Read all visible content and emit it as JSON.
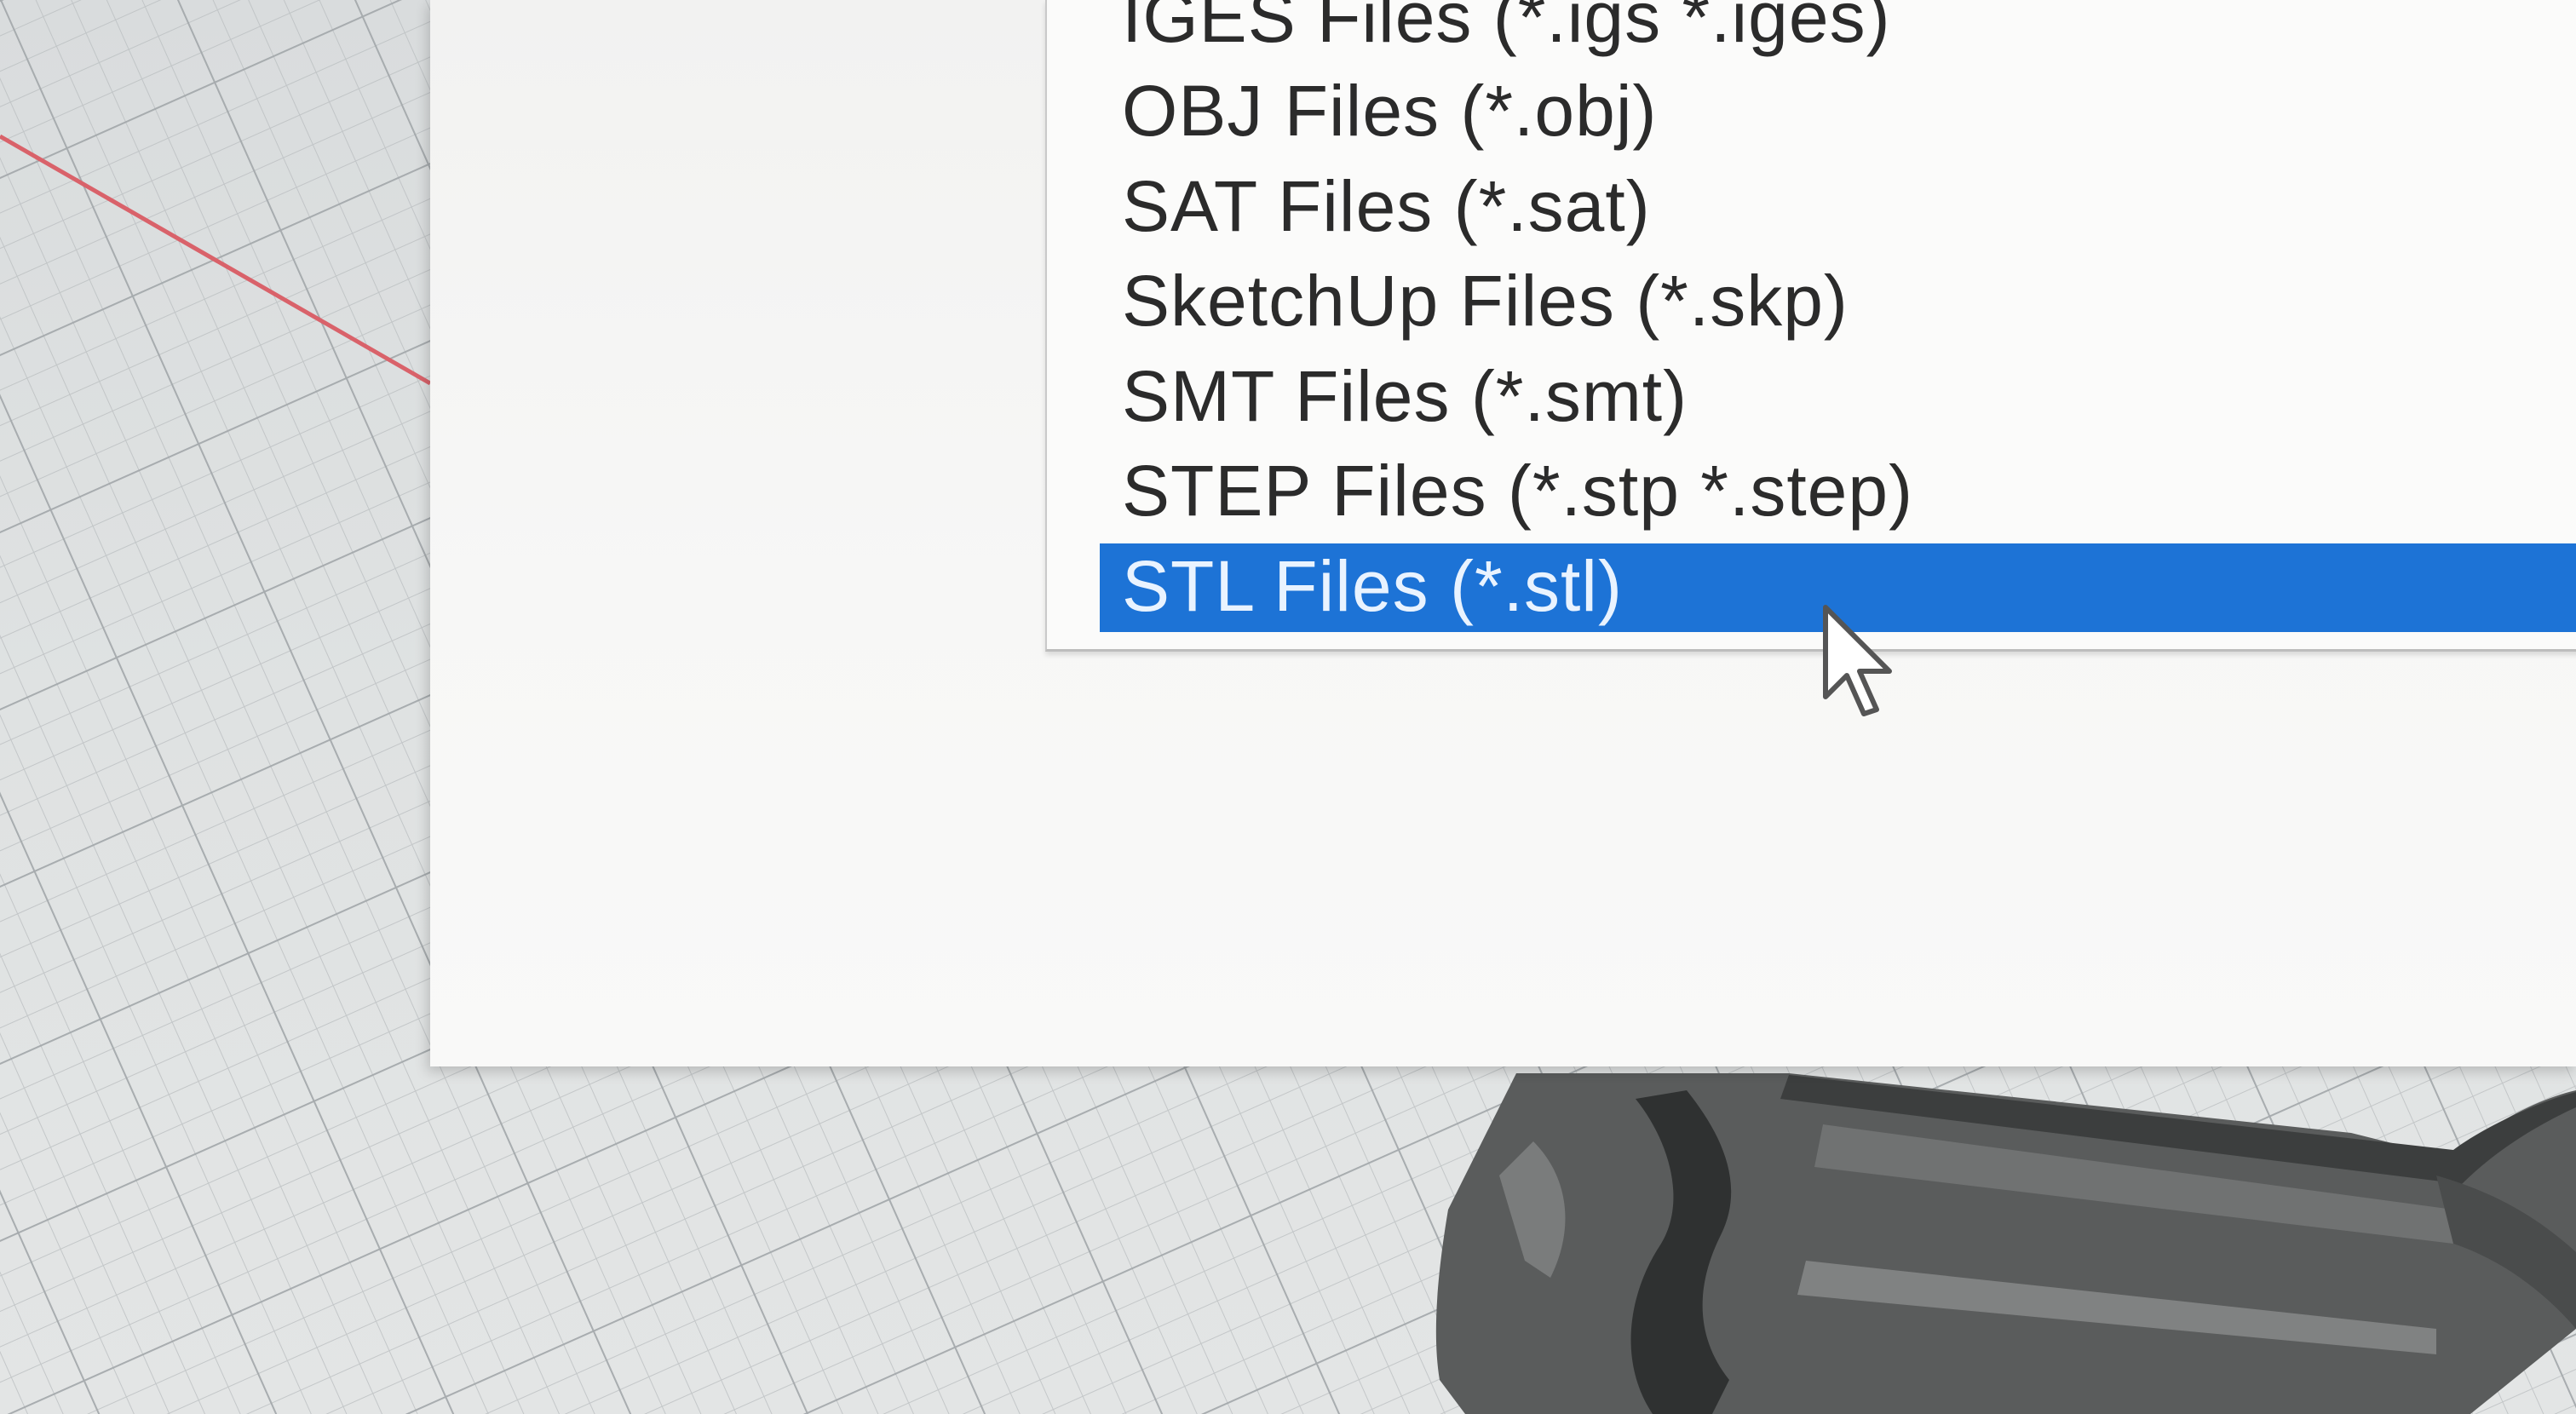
{
  "file_type_list": {
    "items": [
      {
        "label": "IGES Files (*.igs *.iges)",
        "selected": false
      },
      {
        "label": "OBJ Files (*.obj)",
        "selected": false
      },
      {
        "label": "SAT Files (*.sat)",
        "selected": false
      },
      {
        "label": "SketchUp Files (*.skp)",
        "selected": false
      },
      {
        "label": "SMT Files (*.smt)",
        "selected": false
      },
      {
        "label": "STEP Files (*.stp *.step)",
        "selected": false
      },
      {
        "label": "STL Files (*.stl)",
        "selected": true
      }
    ]
  },
  "colors": {
    "selection": "#1d73d6",
    "selection_text": "#e9f3ff",
    "dialog_bg": "#f5f5f4",
    "grid_line": "#a9aeb1",
    "axis_line": "#d9626a",
    "model": "#5a5c5c"
  },
  "icons": {
    "cursor": "arrow-cursor-icon"
  }
}
